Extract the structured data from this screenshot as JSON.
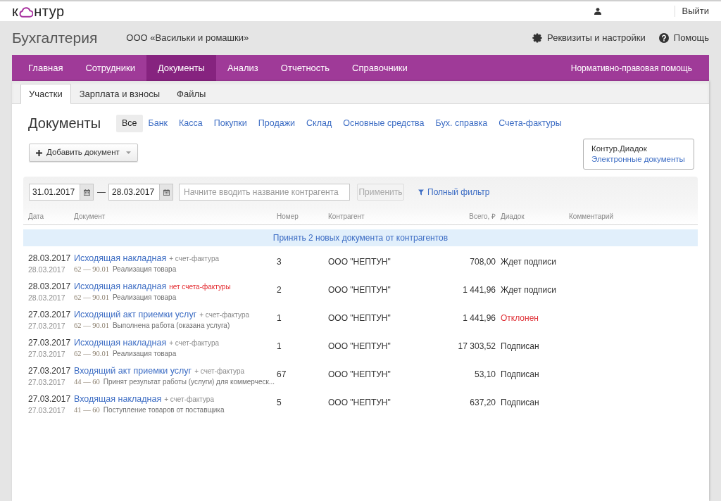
{
  "topbar": {
    "logo": {
      "prefix": "к",
      "suffix": "нтур"
    },
    "logout": "Выйти"
  },
  "header": {
    "title": "Бухгалтерия",
    "organization": "ООО «Васильки и ромашки»",
    "links": [
      {
        "label": "Реквизиты и настройки",
        "kind": "settings"
      },
      {
        "label": "Помощь",
        "kind": "help"
      }
    ]
  },
  "nav": {
    "items": [
      {
        "label": "Главная",
        "selected": false
      },
      {
        "label": "Сотрудники",
        "selected": false
      },
      {
        "label": "Документы",
        "selected": true
      },
      {
        "label": "Анализ",
        "selected": false
      },
      {
        "label": "Отчетность",
        "selected": false
      },
      {
        "label": "Справочники",
        "selected": false
      }
    ],
    "right_link": "Нормативно-правовая помощь"
  },
  "subtabs": [
    {
      "label": "Участки",
      "selected": true
    },
    {
      "label": "Зарплата и взносы",
      "selected": false
    },
    {
      "label": "Файлы",
      "selected": false
    }
  ],
  "documents": {
    "title": "Документы",
    "filters": [
      {
        "label": "Все",
        "selected": true
      },
      {
        "label": "Банк",
        "selected": false
      },
      {
        "label": "Касса",
        "selected": false
      },
      {
        "label": "Покупки",
        "selected": false
      },
      {
        "label": "Продажи",
        "selected": false
      },
      {
        "label": "Склад",
        "selected": false
      },
      {
        "label": "Основные средства",
        "selected": false
      },
      {
        "label": "Бух. справка",
        "selected": false
      },
      {
        "label": "Счета-фактуры",
        "selected": false
      }
    ],
    "add_button": "Добавить документ",
    "diadoc": {
      "title": "Контур.Диадок",
      "link": "Электронные документы"
    }
  },
  "filter_bar": {
    "date_from": "31.01.2017",
    "separator": "—",
    "date_to": "28.03.2017",
    "search": {
      "placeholder": "Начните вводить название контрагента"
    },
    "apply_button": {
      "label": "Применить",
      "disabled": true
    },
    "full_filter": "Полный фильтр"
  },
  "table": {
    "columns": [
      "Дата",
      "Документ",
      "Номер",
      "Контрагент",
      "Всего, ₽",
      "Диадок",
      "Комментарий"
    ],
    "banner": "Принять 2 новых документа от контрагентов",
    "rows": [
      {
        "date": "28.03.2017",
        "posting_date": "28.03.2017",
        "document": "Исходящая накладная",
        "invoice": {
          "text": "+ счет-фактура",
          "kind": "attached"
        },
        "accounts": "62 — 90.01",
        "operation": "Реализация товара",
        "number": "3",
        "counterparty": "ООО \"НЕПТУН\"",
        "total": "708,00",
        "diadoc": {
          "text": "Ждет подписи",
          "kind": "waiting"
        }
      },
      {
        "date": "28.03.2017",
        "posting_date": "28.03.2017",
        "document": "Исходящая накладная",
        "invoice": {
          "text": "нет счета-фактуры",
          "kind": "missing"
        },
        "accounts": "62 — 90.01",
        "operation": "Реализация товара",
        "number": "2",
        "counterparty": "ООО \"НЕПТУН\"",
        "total": "1 441,96",
        "diadoc": {
          "text": "Ждет подписи",
          "kind": "waiting"
        }
      },
      {
        "date": "27.03.2017",
        "posting_date": "27.03.2017",
        "document": "Исходящий акт приемки услуг",
        "invoice": {
          "text": "+ счет-фактура",
          "kind": "attached"
        },
        "accounts": "62 — 90.01",
        "operation": "Выполнена работа (оказана услуга)",
        "number": "1",
        "counterparty": "ООО \"НЕПТУН\"",
        "total": "1 441,96",
        "diadoc": {
          "text": "Отклонен",
          "kind": "rejected"
        }
      },
      {
        "date": "27.03.2017",
        "posting_date": "27.03.2017",
        "document": "Исходящая накладная",
        "invoice": {
          "text": "+ счет-фактура",
          "kind": "attached"
        },
        "accounts": "62 — 90.01",
        "operation": "Реализация товара",
        "number": "1",
        "counterparty": "ООО \"НЕПТУН\"",
        "total": "17 303,52",
        "diadoc": {
          "text": "Подписан",
          "kind": "signed"
        }
      },
      {
        "date": "27.03.2017",
        "posting_date": "27.03.2017",
        "document": "Входящий акт приемки услуг",
        "invoice": {
          "text": "+ счет-фактура",
          "kind": "attached"
        },
        "accounts": "44 — 60",
        "operation": "Принят результат работы (услуги) для коммерческ...",
        "number": "67",
        "counterparty": "ООО \"НЕПТУН\"",
        "total": "53,10",
        "diadoc": {
          "text": "Подписан",
          "kind": "signed"
        }
      },
      {
        "date": "27.03.2017",
        "posting_date": "27.03.2017",
        "document": "Входящая накладная",
        "invoice": {
          "text": "+ счет-фактура",
          "kind": "attached"
        },
        "accounts": "41 — 60",
        "operation": "Поступление товаров от поставщика",
        "number": "5",
        "counterparty": "ООО \"НЕПТУН\"",
        "total": "637,20",
        "diadoc": {
          "text": "Подписан",
          "kind": "signed"
        }
      }
    ]
  }
}
